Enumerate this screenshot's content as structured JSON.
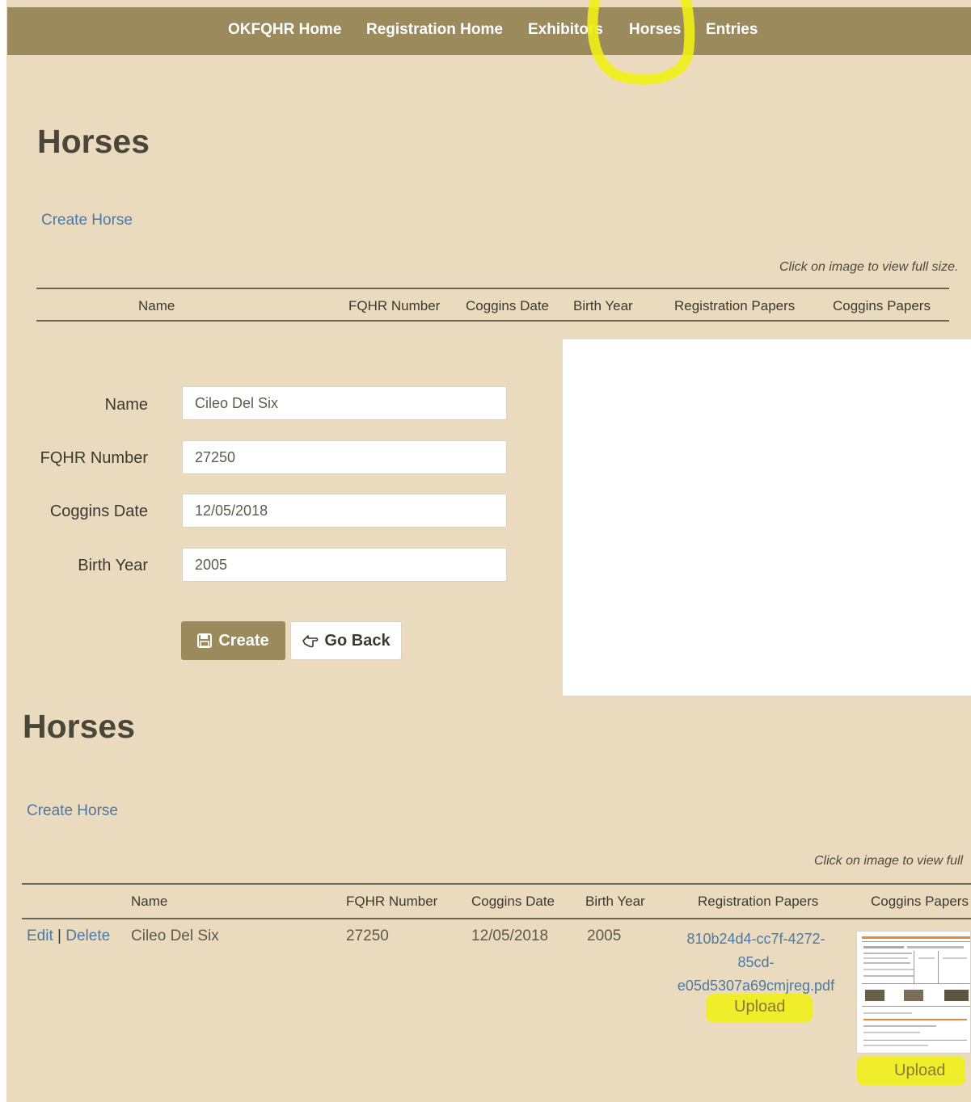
{
  "nav": {
    "items": [
      "OKFQHR Home",
      "Registration Home",
      "Exhibitors",
      "Horses",
      "Entries"
    ],
    "active": "Horses"
  },
  "top": {
    "title": "Horses",
    "create_link": "Create Horse",
    "hint": "Click on image to view full size.",
    "columns": [
      "Name",
      "FQHR Number",
      "Coggins Date",
      "Birth Year",
      "Registration Papers",
      "Coggins Papers"
    ]
  },
  "form": {
    "name_label": "Name",
    "name_value": "Cileo Del Six",
    "fqhr_label": "FQHR Number",
    "fqhr_value": "27250",
    "coggins_label": "Coggins Date",
    "coggins_value": "12/05/2018",
    "birth_label": "Birth Year",
    "birth_value": "2005",
    "create_button": "Create",
    "back_button": "Go Back",
    "create_icon": "floppy-disk-icon",
    "back_icon": "hand-pointer-icon"
  },
  "bottom": {
    "title": "Horses",
    "create_link": "Create Horse",
    "hint": "Click on image to view full",
    "columns": [
      "Name",
      "FQHR Number",
      "Coggins Date",
      "Birth Year",
      "Registration Papers",
      "Coggins Papers"
    ],
    "row": {
      "edit": "Edit",
      "separator": "|",
      "delete": "Delete",
      "name": "Cileo Del Six",
      "fqhr": "27250",
      "coggins_date": "12/05/2018",
      "birth_year": "2005",
      "reg_file_line1": "810b24d4-cc7f-4272-",
      "reg_file_line2": "85cd-",
      "reg_file_line3": "e05d5307a69cmjreg.pdf",
      "reg_upload": "Upload",
      "coggins_upload": "Upload"
    }
  },
  "colors": {
    "nav_bg": "#9b8a5c",
    "page_bg": "#eadbbe",
    "link": "#4d78a5",
    "highlight": "#f0ef16"
  }
}
